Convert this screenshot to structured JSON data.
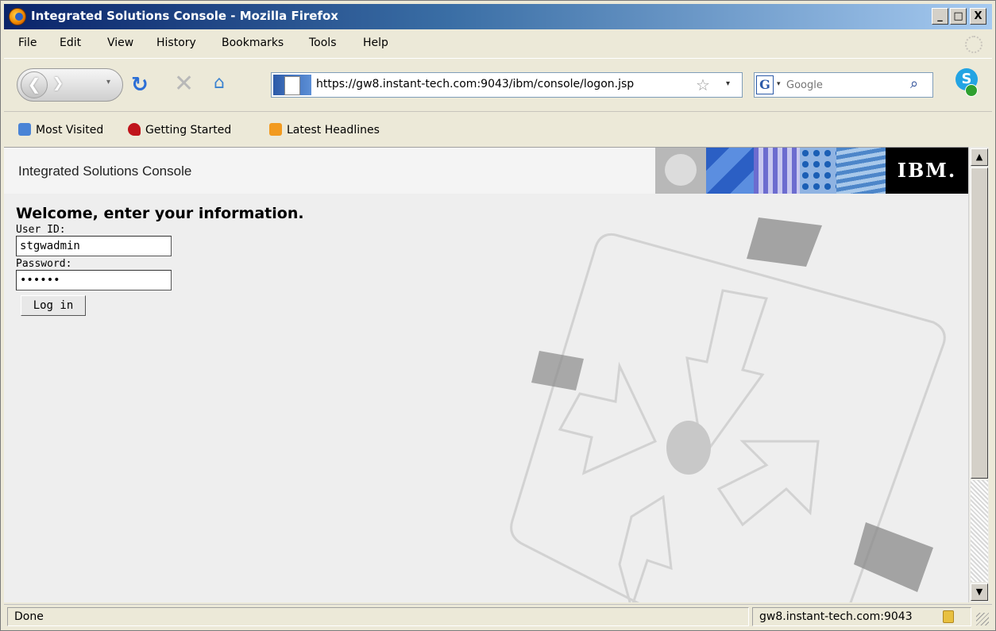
{
  "window": {
    "title": "Integrated Solutions Console - Mozilla Firefox",
    "controls": {
      "minimize": "_",
      "maximize": "□",
      "close": "X"
    }
  },
  "menu": {
    "items": [
      {
        "label": "File"
      },
      {
        "label": "Edit"
      },
      {
        "label": "View"
      },
      {
        "label": "History"
      },
      {
        "label": "Bookmarks"
      },
      {
        "label": "Tools"
      },
      {
        "label": "Help"
      }
    ]
  },
  "navbar": {
    "url": "https://gw8.instant-tech.com:9043/ibm/console/logon.jsp",
    "search_placeholder": "Google",
    "search_engine_letter": "G",
    "icons": [
      "back-icon",
      "forward-icon",
      "reload-icon",
      "stop-icon",
      "home-icon",
      "bookmark-star-icon",
      "search-icon",
      "skype-icon"
    ]
  },
  "bookmarks": {
    "items": [
      {
        "label": "Most Visited",
        "icon": "most-visited-icon"
      },
      {
        "label": "Getting Started",
        "icon": "getting-started-icon"
      },
      {
        "label": "Latest Headlines",
        "icon": "rss-icon"
      }
    ]
  },
  "page": {
    "app_title": "Integrated Solutions Console",
    "brand": "IBM.",
    "login": {
      "heading": "Welcome, enter your information.",
      "userid_label": "User ID:",
      "userid_value": "stgwadmin",
      "password_label": "Password:",
      "password_value": "••••••",
      "submit_label": "Log in"
    }
  },
  "status": {
    "text": "Done",
    "host": "gw8.instant-tech.com:9043"
  },
  "colors": {
    "titlebar_start": "#0a246a",
    "titlebar_end": "#a6caf0",
    "page_bg": "#eeeeee",
    "banner_bg": "#f4f4f4",
    "brand_bg": "#000000"
  }
}
